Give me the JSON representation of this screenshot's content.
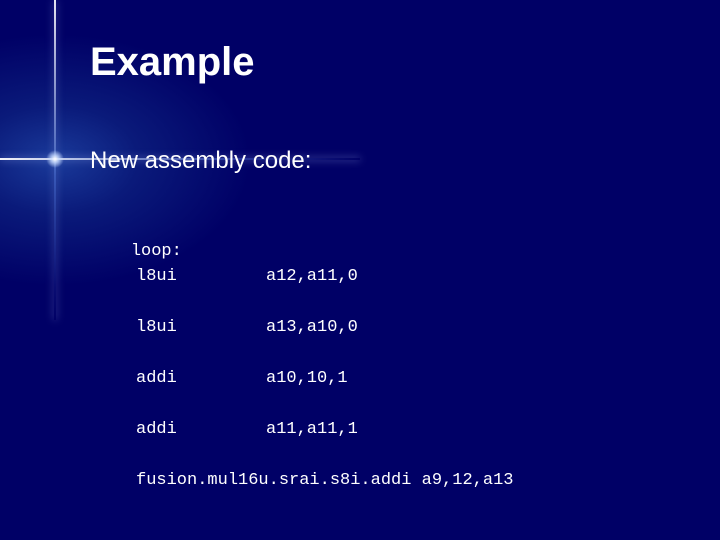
{
  "slide": {
    "title": "Example",
    "subtitle": "New assembly code:"
  },
  "code": {
    "label": "loop:",
    "instructions": [
      {
        "mnemonic": "l8ui",
        "operands": "a12,a11,0"
      },
      {
        "mnemonic": "l8ui",
        "operands": "a13,a10,0"
      },
      {
        "mnemonic": "addi",
        "operands": "a10,10,1"
      },
      {
        "mnemonic": "addi",
        "operands": "a11,a11,1"
      },
      {
        "mnemonic": "fusion.mul16u.srai.s8i.addi",
        "operands": "a9,12,a13"
      }
    ]
  }
}
